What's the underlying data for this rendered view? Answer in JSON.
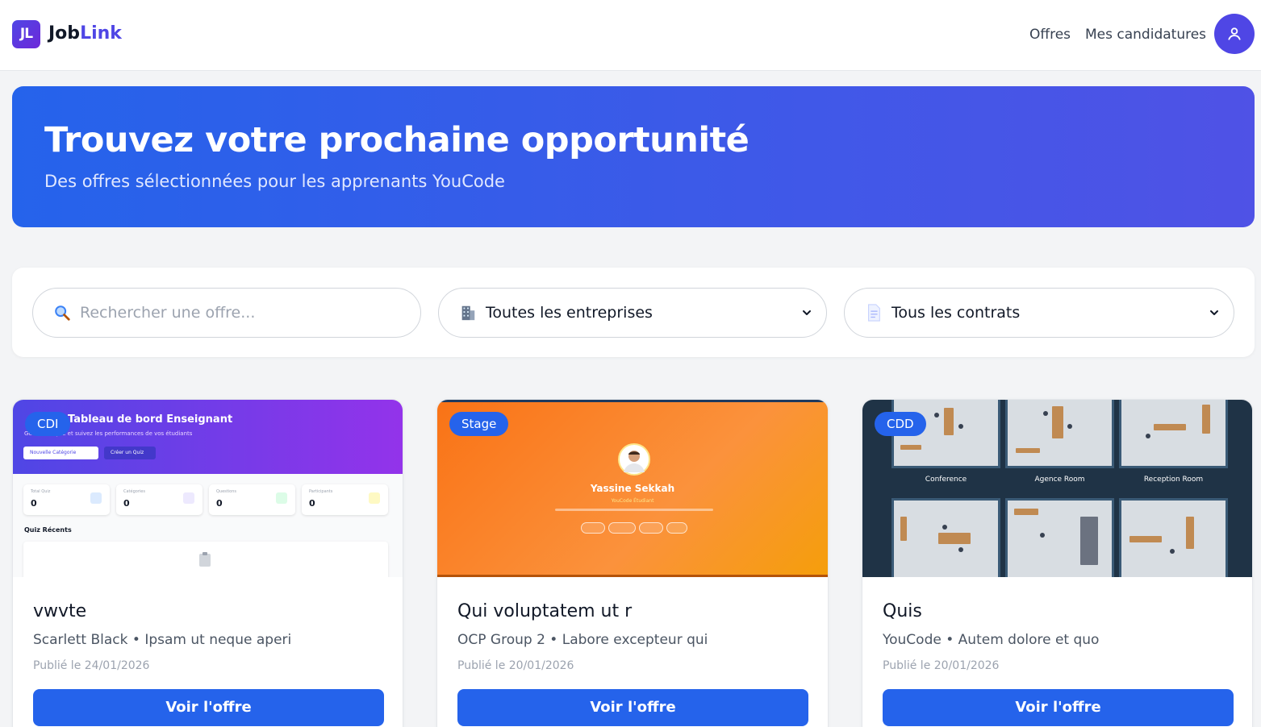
{
  "header": {
    "logo_mark": "JL",
    "brand_primary": "Job",
    "brand_accent": "Link",
    "nav": {
      "offres": "Offres",
      "candidatures": "Mes candidatures"
    },
    "avatar_icon": "user-icon"
  },
  "hero": {
    "title": "Trouvez votre prochaine opportunité",
    "subtitle": "Des offres sélectionnées pour les apprenants YouCode"
  },
  "filters": {
    "search": {
      "icon": "search-icon",
      "placeholder": "Rechercher une offre..."
    },
    "company": {
      "icon": "building-icon",
      "selected": "Toutes les entreprises"
    },
    "contract": {
      "icon": "document-icon",
      "selected": "Tous les contrats"
    }
  },
  "offers": [
    {
      "badge": "CDI",
      "title": "vwvte",
      "company": "Scarlett Black",
      "location": "Ipsam ut neque aperi",
      "date": "Publié le 24/01/2026",
      "button": "Voir l'offre",
      "thumb": {
        "title": "Tableau de bord Enseignant",
        "subtitle": "Gérez vos quiz et suivez les performances de vos étudiants",
        "btn_a": "Nouvelle Catégorie",
        "btn_b": "Créer un Quiz",
        "stats": [
          {
            "label": "Total Quiz",
            "value": "0"
          },
          {
            "label": "Catégories",
            "value": "0"
          },
          {
            "label": "Questions",
            "value": "0"
          },
          {
            "label": "Participants",
            "value": "0"
          }
        ],
        "recent": "Quiz Récents"
      }
    },
    {
      "badge": "Stage",
      "title": "Qui voluptatem ut r",
      "company": "OCP Group 2",
      "location": "Labore excepteur qui",
      "date": "Publié le 20/01/2026",
      "button": "Voir l'offre",
      "thumb": {
        "name": "Yassine Sekkah",
        "role": "YouCode Étudiant"
      }
    },
    {
      "badge": "CDD",
      "title": "Quis",
      "company": "YouCode",
      "location": "Autem dolore et quo",
      "date": "Publié le 20/01/2026",
      "button": "Voir l'offre",
      "thumb": {
        "rooms": [
          "Conference",
          "Agence Room",
          "Reception Room"
        ]
      }
    }
  ],
  "colors": {
    "primary": "#2563eb",
    "brand": "#4f46e5",
    "hero_end": "#4f52e6"
  }
}
